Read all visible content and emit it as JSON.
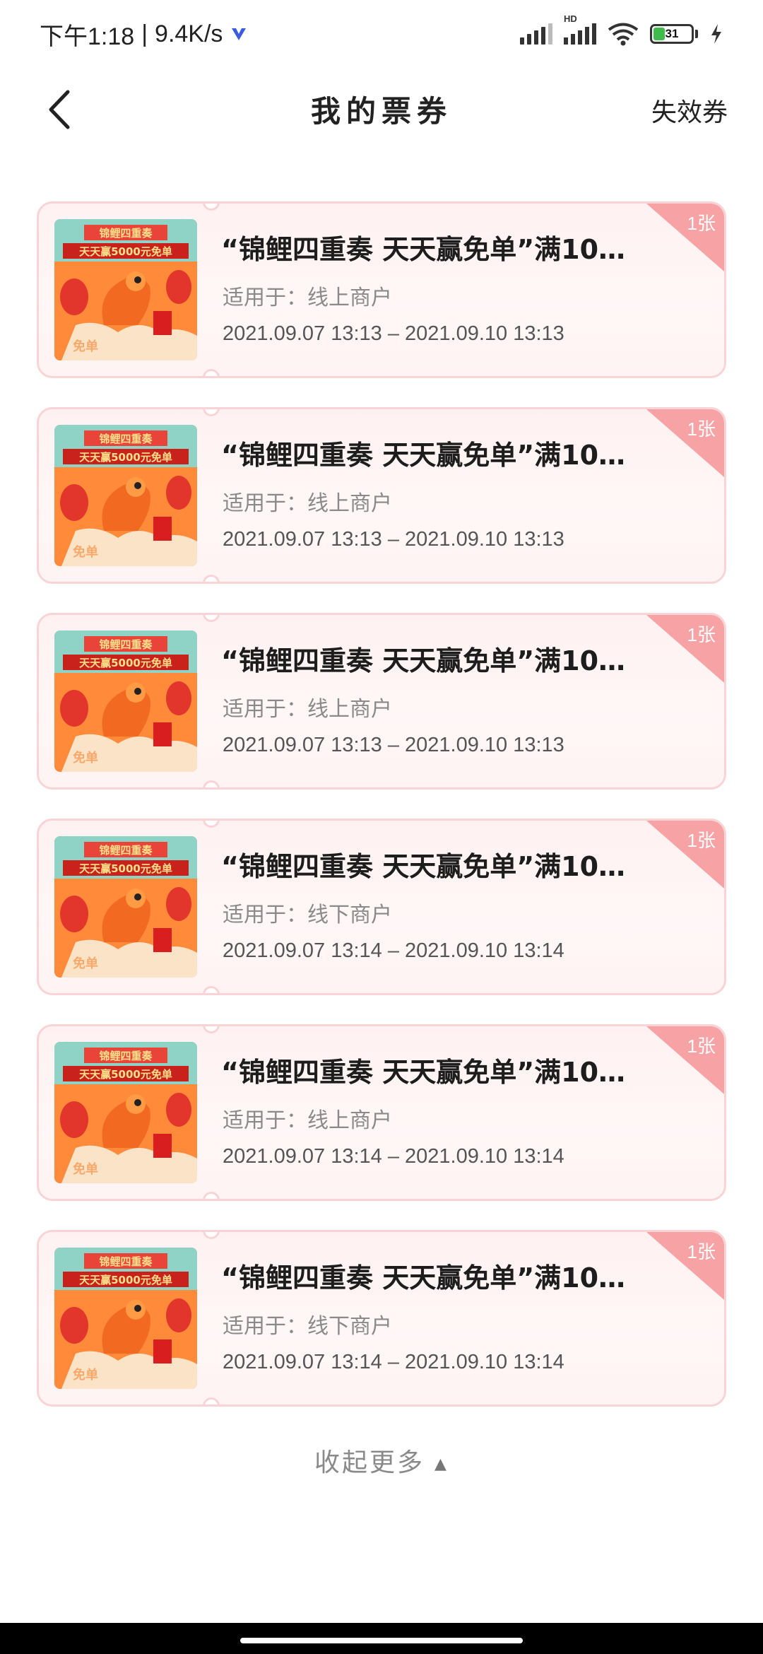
{
  "status_bar": {
    "time": "下午1:18",
    "separator": "|",
    "net_speed": "9.4K/s",
    "hd_label": "HD",
    "battery_level": "31",
    "battery_fraction": 0.31
  },
  "header": {
    "title": "我的票券",
    "right_link": "失效券",
    "back_icon": "chevron-left-icon"
  },
  "coupons": [
    {
      "title": "“锦鲤四重奏 天天赢免单”满10…",
      "scope": "适用于：线上商户",
      "validity": "2021.09.07 13:13 – 2021.09.10 13:13",
      "count": "1张",
      "thumb_title": "锦鲤四重奏",
      "thumb_sub": "天天赢5000元免单",
      "thumb_tag": "免单"
    },
    {
      "title": "“锦鲤四重奏 天天赢免单”满10…",
      "scope": "适用于：线上商户",
      "validity": "2021.09.07 13:13 – 2021.09.10 13:13",
      "count": "1张",
      "thumb_title": "锦鲤四重奏",
      "thumb_sub": "天天赢5000元免单",
      "thumb_tag": "免单"
    },
    {
      "title": "“锦鲤四重奏 天天赢免单”满10…",
      "scope": "适用于：线上商户",
      "validity": "2021.09.07 13:13 – 2021.09.10 13:13",
      "count": "1张",
      "thumb_title": "锦鲤四重奏",
      "thumb_sub": "天天赢5000元免单",
      "thumb_tag": "免单"
    },
    {
      "title": "“锦鲤四重奏 天天赢免单”满10…",
      "scope": "适用于：线下商户",
      "validity": "2021.09.07 13:14 – 2021.09.10 13:14",
      "count": "1张",
      "thumb_title": "锦鲤四重奏",
      "thumb_sub": "天天赢5000元免单",
      "thumb_tag": "免单"
    },
    {
      "title": "“锦鲤四重奏 天天赢免单”满10…",
      "scope": "适用于：线上商户",
      "validity": "2021.09.07 13:14 – 2021.09.10 13:14",
      "count": "1张",
      "thumb_title": "锦鲤四重奏",
      "thumb_sub": "天天赢5000元免单",
      "thumb_tag": "免单"
    },
    {
      "title": "“锦鲤四重奏 天天赢免单”满10…",
      "scope": "适用于：线下商户",
      "validity": "2021.09.07 13:14 – 2021.09.10 13:14",
      "count": "1张",
      "thumb_title": "锦鲤四重奏",
      "thumb_sub": "天天赢5000元免单",
      "thumb_tag": "免单"
    }
  ],
  "collapse_label": "收起更多",
  "collapse_icon": "triangle-up-icon",
  "colors": {
    "card_border": "#f9d4d6",
    "card_bg": "#fff3f3",
    "tag": "#f7a3a6",
    "scope_text": "#8a8a8a"
  }
}
